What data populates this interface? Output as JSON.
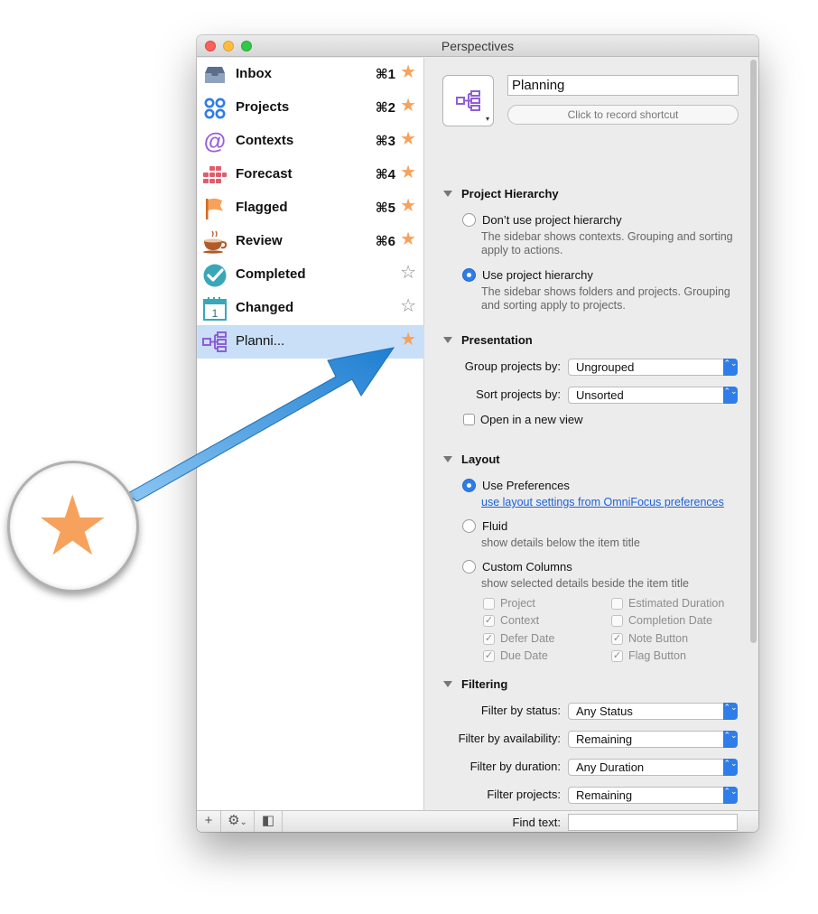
{
  "window": {
    "title": "Perspectives"
  },
  "sidebar": {
    "items": [
      {
        "label": "Inbox",
        "shortcut": "⌘1",
        "star": "★"
      },
      {
        "label": "Projects",
        "shortcut": "⌘2",
        "star": "★"
      },
      {
        "label": "Contexts",
        "shortcut": "⌘3",
        "star": "★"
      },
      {
        "label": "Forecast",
        "shortcut": "⌘4",
        "star": "★"
      },
      {
        "label": "Flagged",
        "shortcut": "⌘5",
        "star": "★"
      },
      {
        "label": "Review",
        "shortcut": "⌘6",
        "star": "★"
      },
      {
        "label": "Completed",
        "shortcut": "",
        "star": "☆"
      },
      {
        "label": "Changed",
        "shortcut": "",
        "star": "☆"
      },
      {
        "label": "Planni...",
        "shortcut": "",
        "star": "★"
      }
    ],
    "bottom": {
      "add": "+",
      "gear": "⚙",
      "gear_caret": "⌄",
      "toggle": "◧"
    }
  },
  "perspective": {
    "name": "Planning",
    "shortcut_button": "Click to record shortcut",
    "caret": "▾"
  },
  "project_hierarchy": {
    "heading": "Project Hierarchy",
    "option1": "Don’t use project hierarchy",
    "option1_desc": "The sidebar shows contexts. Grouping and sorting apply to actions.",
    "option2": "Use project hierarchy",
    "option2_desc": "The sidebar shows folders and projects. Grouping and sorting apply to projects."
  },
  "presentation": {
    "heading": "Presentation",
    "group_label": "Group projects by:",
    "group_value": "Ungrouped",
    "sort_label": "Sort projects by:",
    "sort_value": "Unsorted",
    "open_new_view": "Open in a new view"
  },
  "layout": {
    "heading": "Layout",
    "use_prefs": "Use Preferences",
    "use_prefs_link": "use layout settings from OmniFocus preferences",
    "fluid": "Fluid",
    "fluid_desc": "show details below the item title",
    "custom": "Custom Columns",
    "custom_desc": "show selected details beside the item title",
    "columns_left": [
      {
        "label": "Project",
        "check": ""
      },
      {
        "label": "Context",
        "check": "✓"
      },
      {
        "label": "Defer Date",
        "check": "✓"
      },
      {
        "label": "Due Date",
        "check": "✓"
      }
    ],
    "columns_right": [
      {
        "label": "Estimated Duration",
        "check": ""
      },
      {
        "label": "Completion Date",
        "check": ""
      },
      {
        "label": "Note Button",
        "check": "✓"
      },
      {
        "label": "Flag Button",
        "check": "✓"
      }
    ]
  },
  "filtering": {
    "heading": "Filtering",
    "status_label": "Filter by status:",
    "status_value": "Any Status",
    "availability_label": "Filter by availability:",
    "availability_value": "Remaining",
    "duration_label": "Filter by duration:",
    "duration_value": "Any Duration",
    "projects_label": "Filter projects:",
    "projects_value": "Remaining",
    "find_label": "Find text:"
  },
  "callout": {
    "star": "★"
  },
  "select_arrow": "⌃⌄",
  "colors": {
    "star": "#f7a25c",
    "accent": "#2f7de8",
    "selection": "#c9dff8"
  }
}
